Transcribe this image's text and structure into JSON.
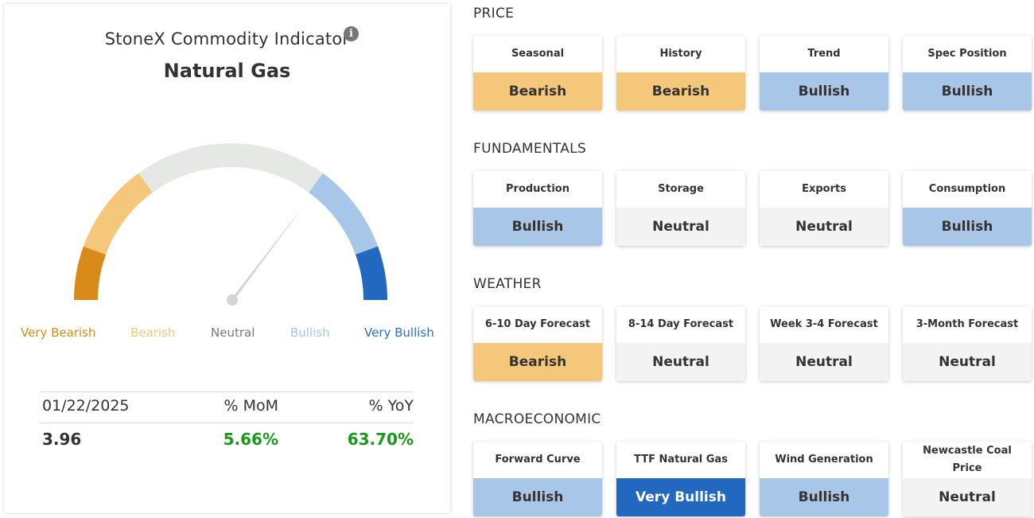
{
  "indicator": {
    "title": "StoneX Commodity Indicator",
    "commodity": "Natural Gas",
    "info_icon": "info-icon",
    "gauge_level": 0.71,
    "legend": [
      {
        "label": "Very Bearish",
        "color": "#D98B1A"
      },
      {
        "label": "Bearish",
        "color": "#F5C77A"
      },
      {
        "label": "Neutral",
        "color": "#7A7A7A"
      },
      {
        "label": "Bullish",
        "color": "#A8C6E8"
      },
      {
        "label": "Very Bullish",
        "color": "#2A6FC2"
      }
    ],
    "stats": {
      "date": "01/22/2025",
      "mom_label": "% MoM",
      "yoy_label": "% YoY",
      "price": "3.96",
      "mom": "5.66%",
      "yoy": "63.70%"
    }
  },
  "colors": {
    "bearish": "#F5C77A",
    "bullish": "#A8C6E8",
    "neutral": "#F2F3F2",
    "very_bullish": "#2268C0",
    "very_bearish": "#D98B1A",
    "positive": "#1A9A1A"
  },
  "sections": [
    {
      "title": "PRICE",
      "tiles": [
        {
          "label": "Seasonal",
          "value": "Bearish"
        },
        {
          "label": "History",
          "value": "Bearish"
        },
        {
          "label": "Trend",
          "value": "Bullish"
        },
        {
          "label": "Spec Position",
          "value": "Bullish"
        }
      ]
    },
    {
      "title": "FUNDAMENTALS",
      "tiles": [
        {
          "label": "Production",
          "value": "Bullish"
        },
        {
          "label": "Storage",
          "value": "Neutral"
        },
        {
          "label": "Exports",
          "value": "Neutral"
        },
        {
          "label": "Consumption",
          "value": "Bullish"
        }
      ]
    },
    {
      "title": "WEATHER",
      "tiles": [
        {
          "label": "6-10 Day Forecast",
          "value": "Bearish"
        },
        {
          "label": "8-14 Day Forecast",
          "value": "Neutral"
        },
        {
          "label": "Week 3-4 Forecast",
          "value": "Neutral"
        },
        {
          "label": "3-Month Forecast",
          "value": "Neutral"
        }
      ]
    },
    {
      "title": "MACROECONOMIC",
      "tiles": [
        {
          "label": "Forward Curve",
          "value": "Bullish"
        },
        {
          "label": "TTF Natural Gas",
          "value": "Very Bullish"
        },
        {
          "label": "Wind Generation",
          "value": "Bullish"
        },
        {
          "label": "Newcastle Coal Price",
          "value": "Neutral"
        }
      ]
    }
  ]
}
